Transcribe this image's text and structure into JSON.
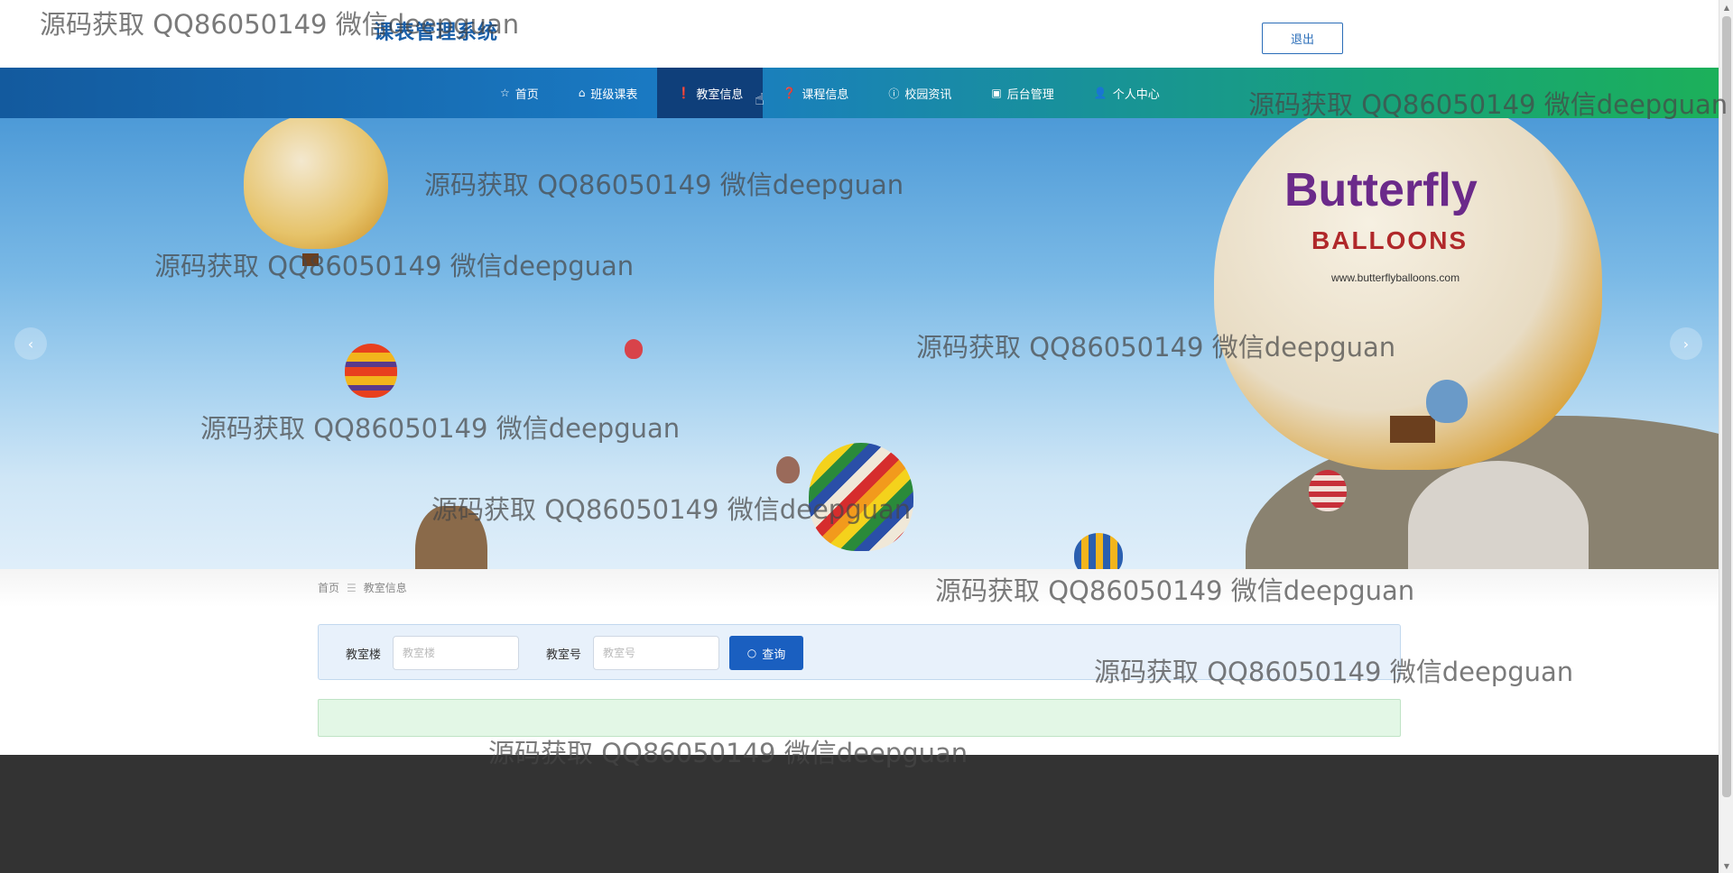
{
  "header": {
    "site_title": "课表管理系统",
    "logout_label": "退出"
  },
  "nav": {
    "items": [
      {
        "label": "首页",
        "icon": "star-icon"
      },
      {
        "label": "班级课表",
        "icon": "bag-icon"
      },
      {
        "label": "教室信息",
        "icon": "info-icon"
      },
      {
        "label": "课程信息",
        "icon": "help-icon"
      },
      {
        "label": "校园资讯",
        "icon": "info-icon"
      },
      {
        "label": "后台管理",
        "icon": "building-icon"
      },
      {
        "label": "个人中心",
        "icon": "user-icon"
      }
    ],
    "active_index": 2
  },
  "banner": {
    "prev_icon": "chevron-left-icon",
    "next_icon": "chevron-right-icon",
    "balloon_text_1": "Butterfly",
    "balloon_text_2": "BALLOONS",
    "balloon_url": "www.butterflyballoons.com"
  },
  "breadcrumb": {
    "home": "首页",
    "separator": "☰",
    "current": "教室信息"
  },
  "search": {
    "building_label": "教室楼",
    "building_placeholder": "教室楼",
    "room_label": "教室号",
    "room_placeholder": "教室号",
    "button_label": "查询"
  },
  "watermark": "源码获取 QQ86050149 微信deepguan",
  "colors": {
    "brand_blue": "#1a5fa8",
    "nav_active": "#0f3f7a",
    "button_blue": "#1a5fc0",
    "footer": "#333333",
    "result_green": "#e3f7e6"
  }
}
